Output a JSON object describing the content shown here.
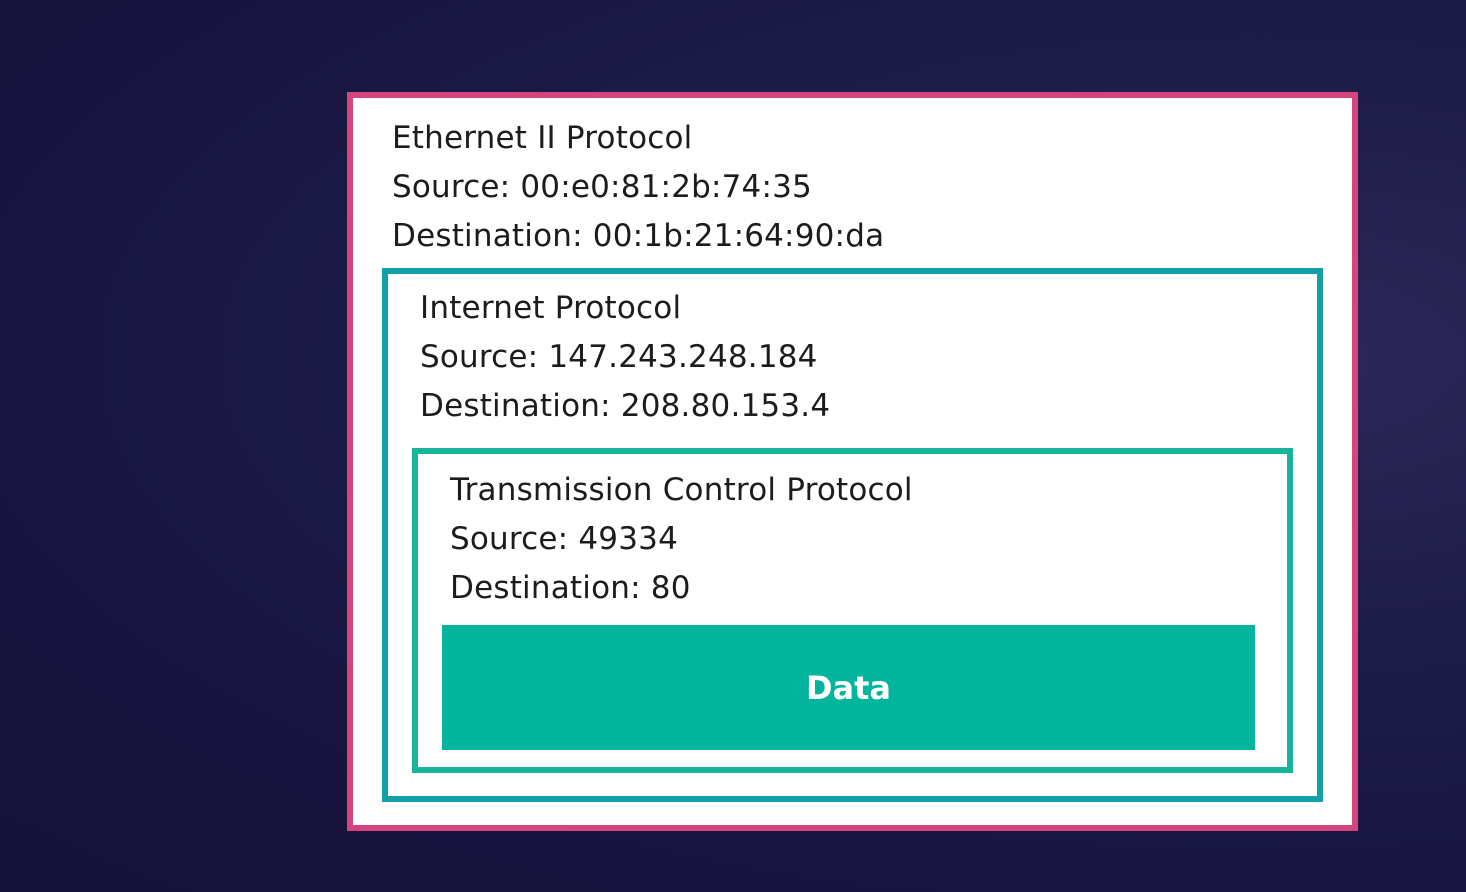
{
  "ethernet": {
    "title": "Ethernet II Protocol",
    "source": "Source: 00:e0:81:2b:74:35",
    "destination": "Destination: 00:1b:21:64:90:da",
    "border_color": "#d5457d"
  },
  "ip": {
    "title": "Internet Protocol",
    "source": "Source: 147.243.248.184",
    "destination": "Destination: 208.80.153.4",
    "border_color": "#14a0a8"
  },
  "tcp": {
    "title": "Transmission Control Protocol",
    "source": "Source: 49334",
    "destination": "Destination: 80",
    "border_color": "#19b49c"
  },
  "data": {
    "label": "Data",
    "color": "#02b59c"
  }
}
